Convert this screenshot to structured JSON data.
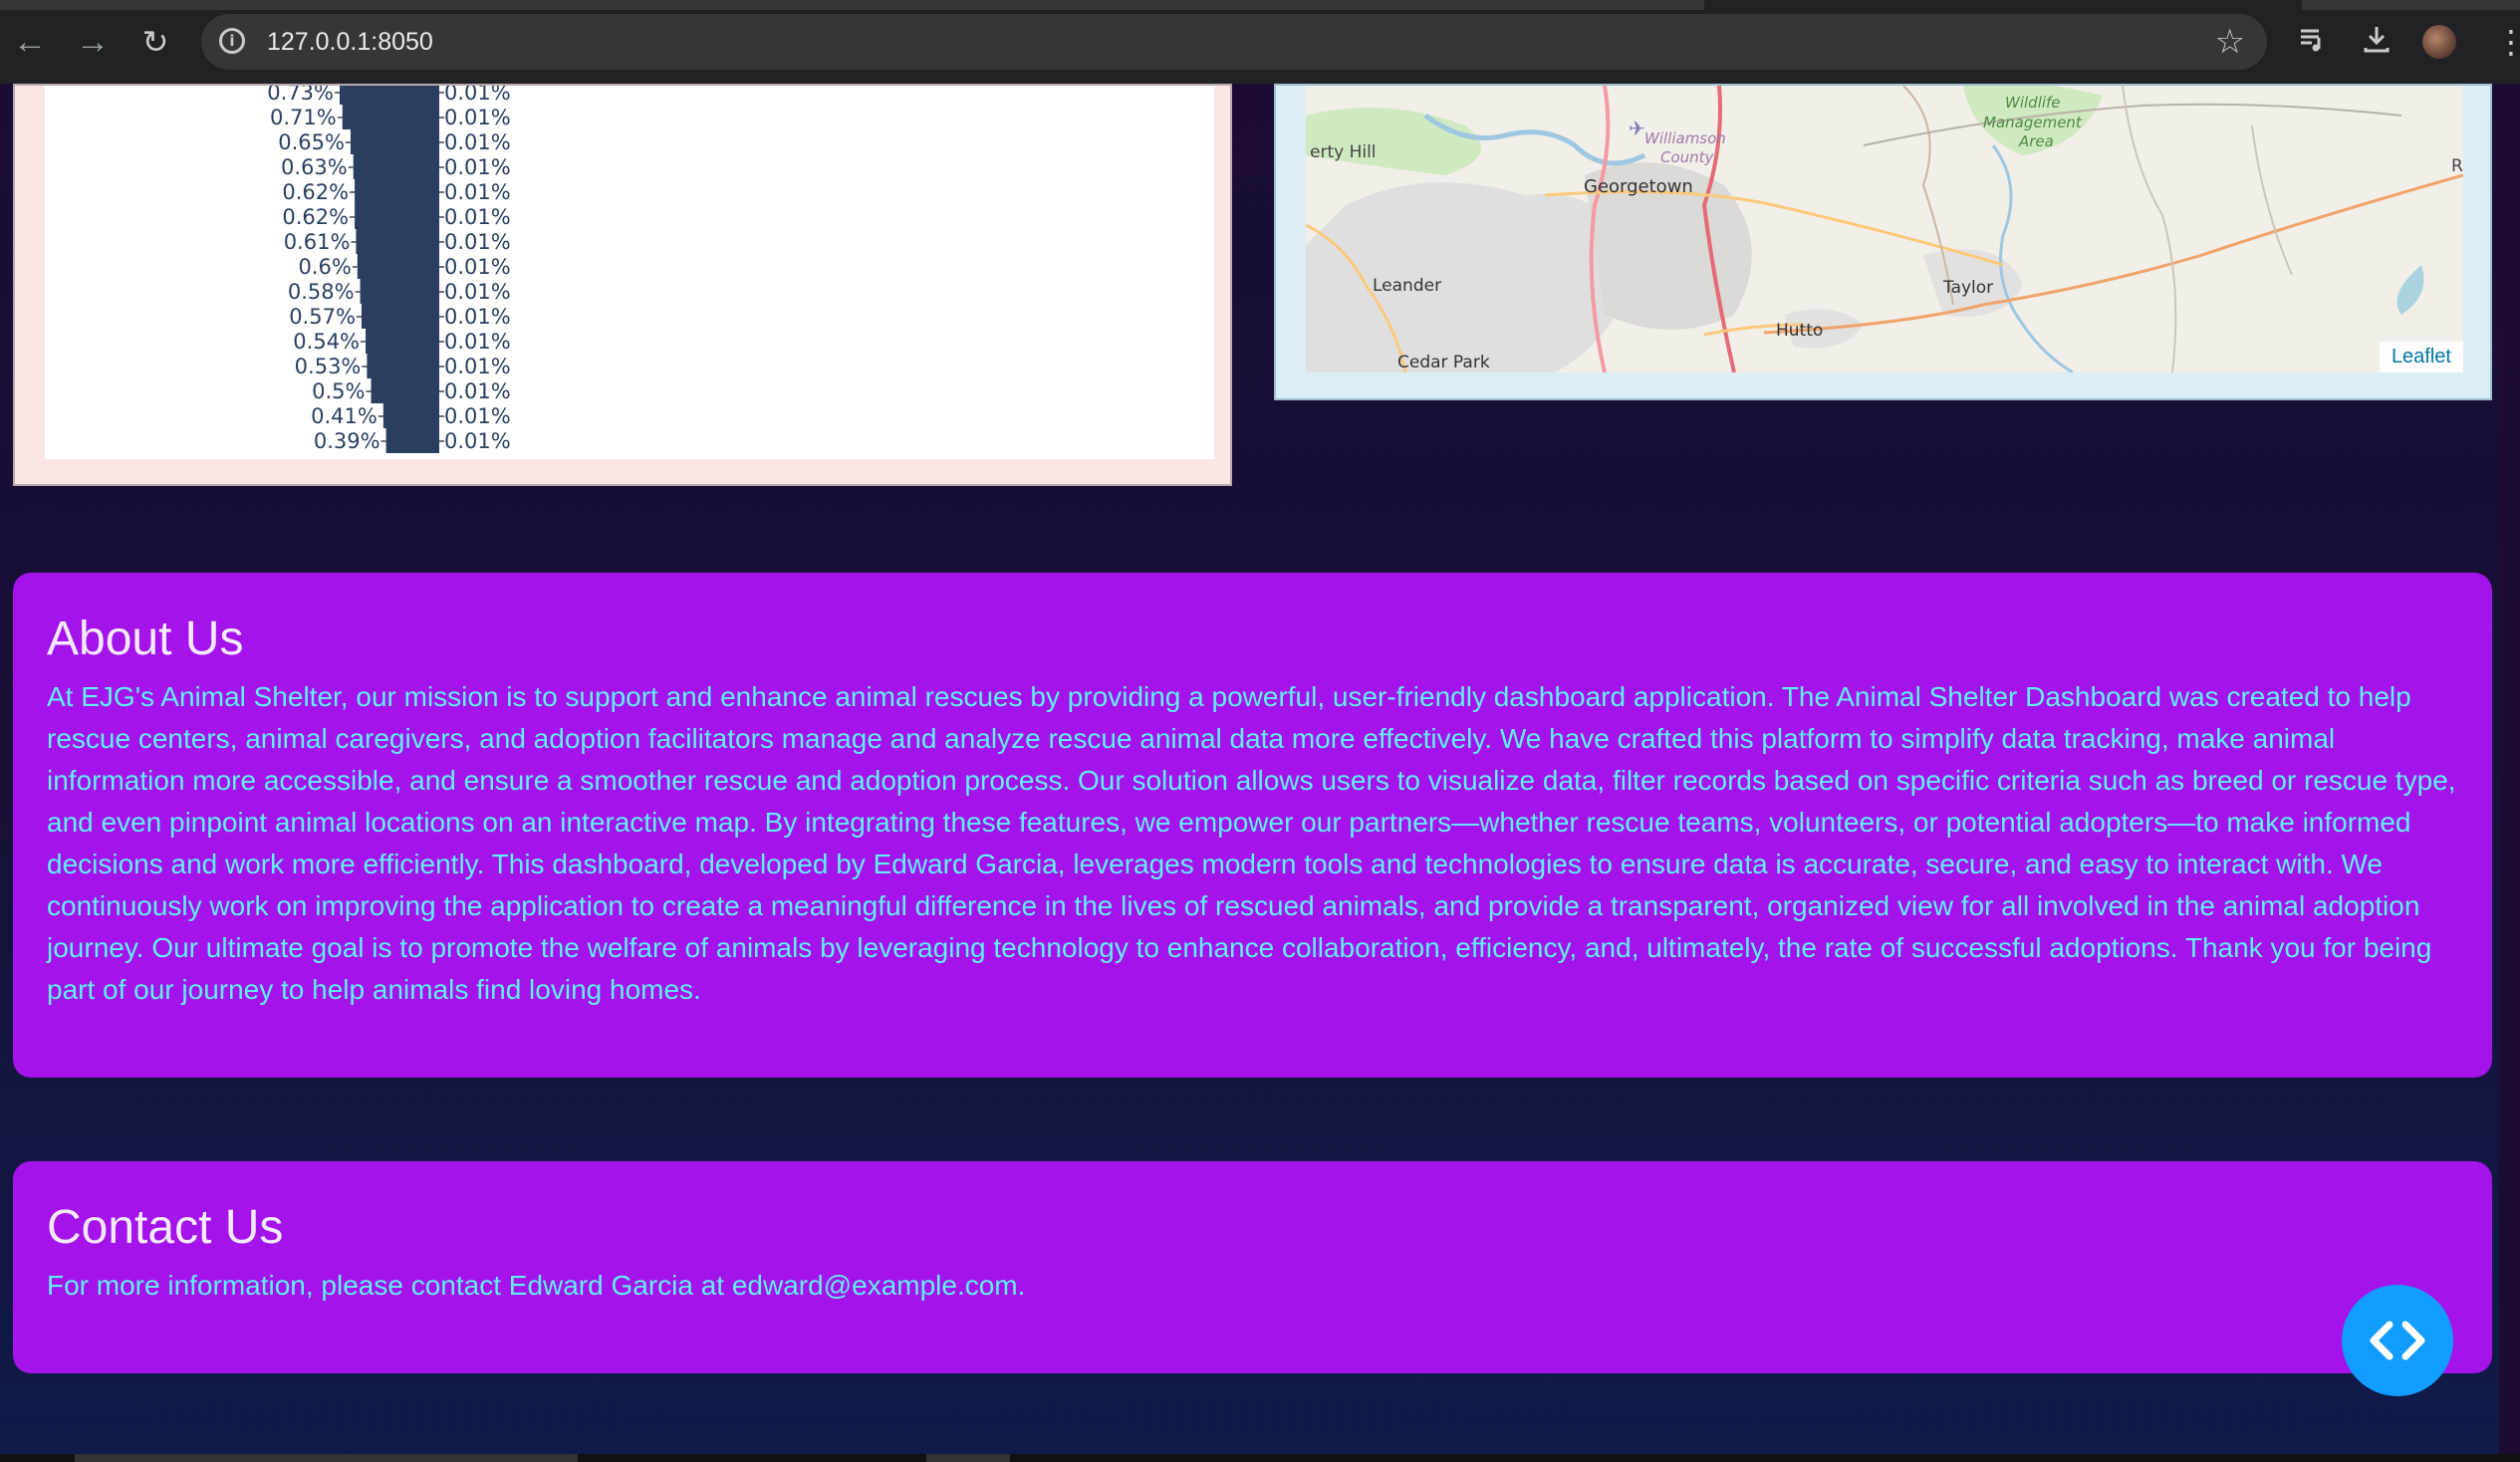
{
  "browser": {
    "url": "127.0.0.1:8050",
    "back_icon": "arrow-left-icon",
    "forward_icon": "arrow-right-icon",
    "reload_icon": "reload-icon"
  },
  "chart_data": {
    "type": "bar",
    "orientation": "horizontal",
    "left_axis_labels": [
      "0.73%",
      "0.71%",
      "0.65%",
      "0.63%",
      "0.62%",
      "0.62%",
      "0.61%",
      "0.6%",
      "0.58%",
      "0.57%",
      "0.54%",
      "0.53%",
      "0.5%",
      "0.41%",
      "0.39%"
    ],
    "right_axis_labels": [
      "0.01%",
      "0.01%",
      "0.01%",
      "0.01%",
      "0.01%",
      "0.01%",
      "0.01%",
      "0.01%",
      "0.01%",
      "0.01%",
      "0.01%",
      "0.01%",
      "0.01%",
      "0.01%",
      "0.01%"
    ],
    "values": [
      0.73,
      0.71,
      0.65,
      0.63,
      0.62,
      0.62,
      0.61,
      0.6,
      0.58,
      0.57,
      0.54,
      0.53,
      0.5,
      0.41,
      0.39
    ],
    "bar_color": "#2a3f5f"
  },
  "map": {
    "labels": [
      "Georgetown",
      "Williamson County",
      "Leander",
      "Taylor",
      "Hutto",
      "Cedar Park",
      "Liberty Hill",
      "Granger Wildlife Management Area"
    ],
    "attribution": "Leaflet"
  },
  "about": {
    "title": "About Us",
    "text": "At EJG's Animal Shelter, our mission is to support and enhance animal rescues by providing a powerful, user-friendly dashboard application. The Animal Shelter Dashboard was created to help rescue centers, animal caregivers, and adoption facilitators manage and analyze rescue animal data more effectively. We have crafted this platform to simplify data tracking, make animal information more accessible, and ensure a smoother rescue and adoption process. Our solution allows users to visualize data, filter records based on specific criteria such as breed or rescue type, and even pinpoint animal locations on an interactive map. By integrating these features, we empower our partners—whether rescue teams, volunteers, or potential adopters—to make informed decisions and work more efficiently. This dashboard, developed by Edward Garcia, leverages modern tools and technologies to ensure data is accurate, secure, and easy to interact with. We continuously work on improving the application to create a meaningful difference in the lives of rescued animals, and provide a transparent, organized view for all involved in the animal adoption journey. Our ultimate goal is to promote the welfare of animals by leveraging technology to enhance collaboration, efficiency, and, ultimately, the rate of successful adoptions. Thank you for being part of our journey to help animals find loving homes."
  },
  "contact": {
    "title": "Contact Us",
    "text": "For more information, please contact Edward Garcia at edward@example.com."
  },
  "colors": {
    "card_bg": "#a313ea",
    "card_text": "#5ff0ff",
    "fab": "#119dff"
  }
}
